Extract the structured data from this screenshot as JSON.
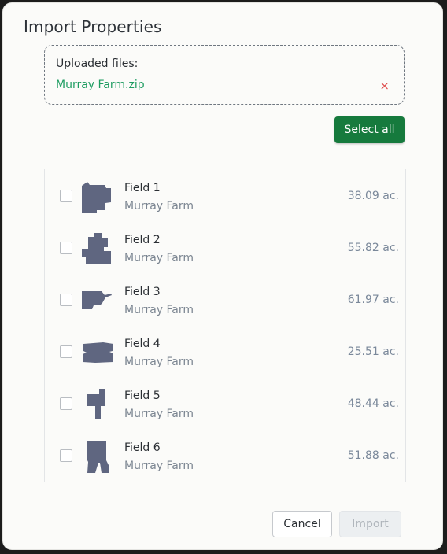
{
  "dialog": {
    "title": "Import Properties"
  },
  "upload": {
    "label": "Uploaded files:",
    "file_name": "Murray Farm.zip",
    "remove_symbol": "×"
  },
  "select_all_label": "Select all",
  "fields": [
    {
      "name": "Field 1",
      "farm": "Murray Farm",
      "acres": "38.09 ac.",
      "checked": false
    },
    {
      "name": "Field 2",
      "farm": "Murray Farm",
      "acres": "55.82 ac.",
      "checked": false
    },
    {
      "name": "Field 3",
      "farm": "Murray Farm",
      "acres": "61.97 ac.",
      "checked": false
    },
    {
      "name": "Field 4",
      "farm": "Murray Farm",
      "acres": "25.51 ac.",
      "checked": false
    },
    {
      "name": "Field 5",
      "farm": "Murray Farm",
      "acres": "48.44 ac.",
      "checked": false
    },
    {
      "name": "Field 6",
      "farm": "Murray Farm",
      "acres": "51.88 ac.",
      "checked": false
    }
  ],
  "footer": {
    "cancel_label": "Cancel",
    "import_label": "Import",
    "import_disabled": true
  },
  "colors": {
    "accent": "#167a3d",
    "file_link": "#1f9d62",
    "remove": "#e05050",
    "field_shape": "#5f6680"
  }
}
